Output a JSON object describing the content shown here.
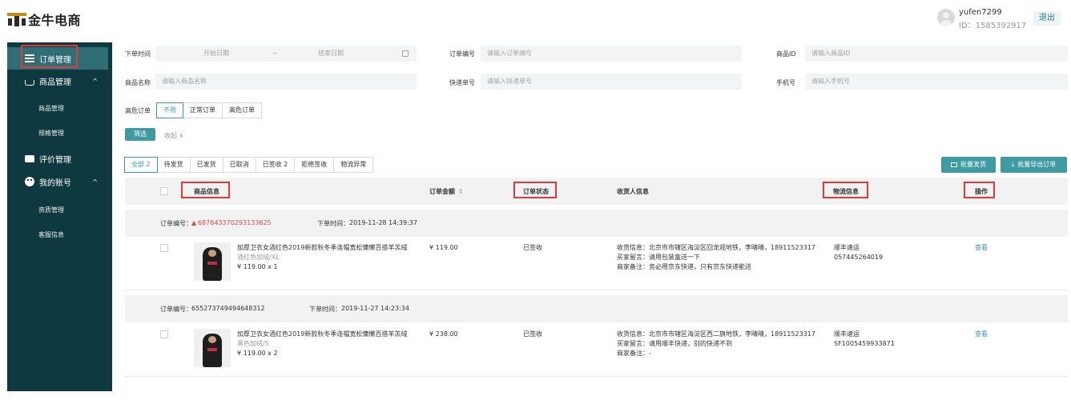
{
  "header": {
    "brand": "金牛电商",
    "username": "yufen7299",
    "user_id": "ID：1585392917",
    "logout": "退出"
  },
  "sidebar": {
    "items": [
      {
        "label": "订单管理",
        "icon": "list-icon",
        "active": true
      },
      {
        "label": "商品管理",
        "icon": "basket-icon",
        "expanded": true,
        "caret": "^"
      },
      {
        "label": "评价管理",
        "icon": "chat-icon"
      },
      {
        "label": "我的账号",
        "icon": "smiley-icon",
        "expanded": true,
        "caret": "^"
      }
    ],
    "goods_sub": [
      "商品管理",
      "规格管理"
    ],
    "account_sub": [
      "资质管理",
      "客服信息"
    ]
  },
  "filters": {
    "order_time_label": "下单时间",
    "start_placeholder": "开始日期",
    "range_sep": "~",
    "end_placeholder": "结束日期",
    "order_no_label": "订单编号",
    "order_no_placeholder": "请输入订单编号",
    "product_id_label": "商品ID",
    "product_id_placeholder": "请输入商品ID",
    "product_name_label": "商品名称",
    "product_name_placeholder": "请输入商品名称",
    "tracking_label": "快递单号",
    "tracking_placeholder": "请输入快递单号",
    "phone_label": "手机号",
    "phone_placeholder": "请输入手机号",
    "risk_label": "高危订单",
    "risk_options": [
      "不限",
      "正常订单",
      "高危订单"
    ],
    "filter_button": "筛选",
    "collapse": "收起 ∧"
  },
  "status_tabs": [
    "全部 2",
    "待发货",
    "已发货",
    "已取消",
    "已签收 2",
    "拒绝签收",
    "物流异常"
  ],
  "actions": {
    "batch_ship": "批量发货",
    "batch_export": "批量导出订单"
  },
  "table": {
    "headers": {
      "product": "商品信息",
      "amount": "订单金额",
      "status": "订单状态",
      "receiver": "收货人信息",
      "logistics": "物流信息",
      "operation": "操作"
    }
  },
  "orders": [
    {
      "order_no_label": "订单编号：",
      "order_no": "687643370293133625",
      "warning": "▲",
      "time_label": "下单时间：",
      "time": "2019-11-28 14:39:37",
      "title": "加厚卫衣女酒红色2019新款秋冬季连帽宽松慵懒百搭羊羔绒",
      "spec": "酒红色加绒/XL",
      "price_qty": "¥ 119.00 x 1",
      "amount": "¥ 119.00",
      "status": "已签收",
      "address": "收货信息：北京市市辖区海淀区回龙观地铁，李晴晴，18911523317",
      "buyer_note": "买家留言：请用包装盒送一下",
      "seller_note": "商家备注：务必用京东快递，只有京东快递能送",
      "carrier": "顺丰速运",
      "tracking": "057445264019",
      "op": "查看"
    },
    {
      "order_no_label": "订单编号：",
      "order_no": "655273749494648312",
      "warning": "",
      "time_label": "下单时间：",
      "time": "2019-11-27 14:23:34",
      "title": "加厚卫衣女酒红色2019新款秋冬季连帽宽松慵懒百搭羊羔绒",
      "spec": "黑色加绒/S",
      "price_qty": "¥ 119.00 x 2",
      "amount": "¥ 238.00",
      "status": "已签收",
      "address": "收货信息：北京市市辖区海淀区西二旗地铁，李晴晴，18911523317",
      "buyer_note": "买家留言：请用顺丰快递，别的快递不到",
      "seller_note": "商家备注：-",
      "carrier": "顺丰速运",
      "tracking": "SF1005459933871",
      "op": "查看"
    }
  ],
  "colors": {
    "accent": "#3f9aa2",
    "sidebar_bg": "#0f3940",
    "sidebar_active": "#2e6e74",
    "highlight_box": "#e03a3a",
    "order_no_red": "#e04848"
  }
}
